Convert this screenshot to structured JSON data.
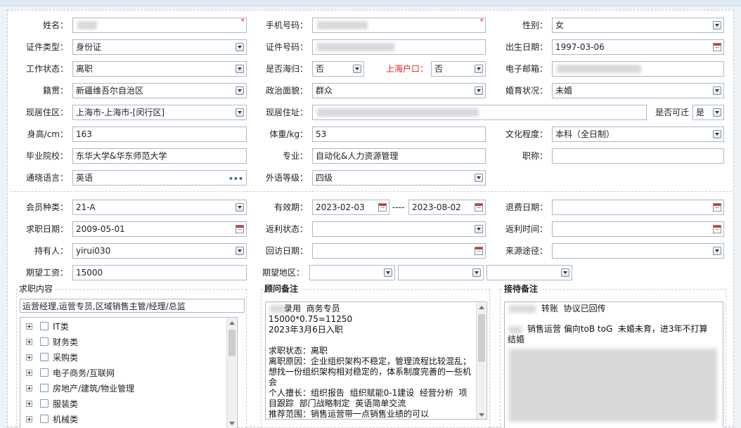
{
  "form": {
    "name_label": "姓名：",
    "phone_label": "手机号码：",
    "gender_label": "性别：",
    "gender_value": "女",
    "id_type_label": "证件类型：",
    "id_type_value": "身份证",
    "id_number_label": "证件号码：",
    "birth_label": "出生日期：",
    "birth_value": "1997-03-06",
    "work_status_label": "工作状态：",
    "work_status_value": "离职",
    "returnee_label": "是否海归：",
    "returnee_value": "否",
    "sh_hukou_label": "上海户口：",
    "sh_hukou_value": "否",
    "email_label": "电子邮箱：",
    "native_label": "籍贯：",
    "native_value": "新疆维吾尔自治区",
    "political_label": "政治面貌：",
    "political_value": "群众",
    "marital_label": "婚育状况：",
    "marital_value": "未婚",
    "residence_area_label": "现居住区：",
    "residence_area_value": "上海市-上海市-[闵行区]",
    "address_label": "现居住址：",
    "relocate_label": "是否可迁",
    "relocate_value": "是",
    "height_label": "身高/cm：",
    "height_value": "163",
    "weight_label": "体重/kg：",
    "weight_value": "53",
    "education_label": "文化程度：",
    "education_value": "本科（全日制）",
    "school_label": "毕业院校：",
    "school_value": "东华大学&华东师范大学",
    "major_label": "专业：",
    "major_value": "自动化&人力资源管理",
    "title_label": "职称：",
    "language_label": "通晓语言：",
    "language_value": "英语",
    "language_more": "•••",
    "language_level_label": "外语等级：",
    "language_level_value": "四级",
    "required_mark": "*"
  },
  "member": {
    "type_label": "会员种类：",
    "type_value": "21-A",
    "valid_label": "有效期：",
    "valid_from": "2023-02-03",
    "valid_sep": "----",
    "valid_to": "2023-08-02",
    "refund_date_label": "退费日期：",
    "job_date_label": "求职日期：",
    "job_date_value": "2009-05-01",
    "rebate_status_label": "返利状态：",
    "rebate_time_label": "返利时间：",
    "holder_label": "持有人：",
    "holder_value": "yirui030",
    "visit_date_label": "回访日期：",
    "source_label": "来源途径：",
    "salary_label": "期望工资：",
    "salary_value": "15000",
    "region_label": "期望地区："
  },
  "job_content": {
    "title": "求职内容",
    "selected": "运营经理,运营专员,区域销售主管/经理/总监",
    "categories": [
      "IT类",
      "财务类",
      "采购类",
      "电子商务/互联网",
      "房地产/建筑/物业管理",
      "服装类",
      "机械类"
    ]
  },
  "consultant_note": {
    "title": "顾问备注",
    "text": "录用  商务专员\n15000*0.75=11250\n2023年3月6日入职\n\n求职状态：离职\n离职原因：企业组织架构不稳定，管理流程比较混乱；想找一份组织架构相对稳定的，体系制度完善的一些机会\n个人擅长：组织报告  组织赋能0-1建设  经营分析  项目跟踪  部门战略制定  英语简单交流\n推荐范围：销售运营带一点销售业绩的可以"
  },
  "reception_note": {
    "title": "接待备注",
    "line1": "转账  协议已回传",
    "line2": "销售运营 偏向toB toG  未婚未育，进3年不打算结婚"
  }
}
